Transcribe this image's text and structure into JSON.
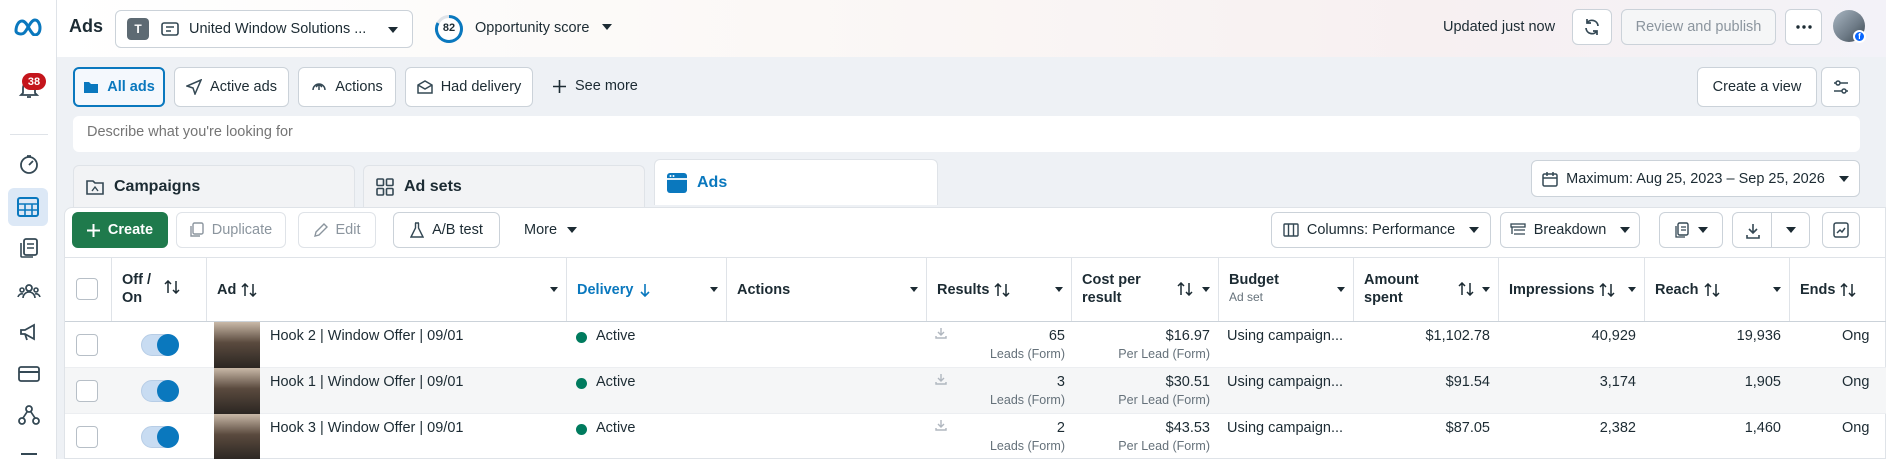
{
  "rail": {
    "notification_count": "38"
  },
  "header": {
    "title": "Ads",
    "account_initial": "T",
    "account_name": "United Window Solutions ...",
    "score_value": "82",
    "score_label": "Opportunity score",
    "updated": "Updated just now",
    "review_publish": "Review and publish"
  },
  "filters": {
    "all_ads": "All ads",
    "active_ads": "Active ads",
    "actions": "Actions",
    "had_delivery": "Had delivery",
    "see_more": "See more",
    "create_view": "Create a view"
  },
  "search": {
    "placeholder": "Describe what you're looking for"
  },
  "tabs": {
    "campaigns": "Campaigns",
    "ad_sets": "Ad sets",
    "ads": "Ads"
  },
  "date_range": "Maximum: Aug 25, 2023 – Sep 25, 2026",
  "actionbar": {
    "create": "Create",
    "duplicate": "Duplicate",
    "edit": "Edit",
    "ab_test": "A/B test",
    "more": "More",
    "columns": "Columns: Performance",
    "breakdown": "Breakdown"
  },
  "columns": {
    "off_on_1": "Off /",
    "off_on_2": "On",
    "ad": "Ad",
    "delivery": "Delivery",
    "actions": "Actions",
    "results": "Results",
    "cost_1": "Cost per",
    "cost_2": "result",
    "budget": "Budget",
    "budget_sub": "Ad set",
    "amount_1": "Amount",
    "amount_2": "spent",
    "impressions": "Impressions",
    "reach": "Reach",
    "ends": "Ends"
  },
  "rows": [
    {
      "name": "Hook 2 | Window Offer | 09/01",
      "delivery": "Active",
      "results": "65",
      "results_type": "Leads (Form)",
      "cost": "$16.97",
      "cost_type": "Per Lead (Form)",
      "budget": "Using campaign...",
      "amount": "$1,102.78",
      "impressions": "40,929",
      "reach": "19,936",
      "ends": "Ong"
    },
    {
      "name": "Hook 1 | Window Offer | 09/01",
      "delivery": "Active",
      "results": "3",
      "results_type": "Leads (Form)",
      "cost": "$30.51",
      "cost_type": "Per Lead (Form)",
      "budget": "Using campaign...",
      "amount": "$91.54",
      "impressions": "3,174",
      "reach": "1,905",
      "ends": "Ong"
    },
    {
      "name": "Hook 3 | Window Offer | 09/01",
      "delivery": "Active",
      "results": "2",
      "results_type": "Leads (Form)",
      "cost": "$43.53",
      "cost_type": "Per Lead (Form)",
      "budget": "Using campaign...",
      "amount": "$87.05",
      "impressions": "2,382",
      "reach": "1,460",
      "ends": "Ong"
    }
  ]
}
